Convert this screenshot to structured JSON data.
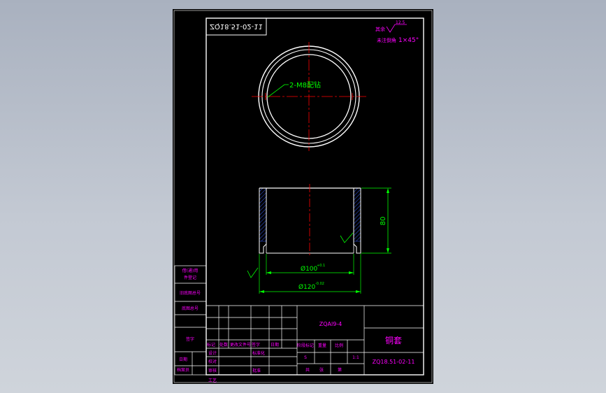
{
  "drawing": {
    "mirrored_code": "ZQ18.51-02-11",
    "roughness_prefix": "其余",
    "roughness_value": "12.5",
    "chamfer_note": "未注倒角",
    "chamfer_value": "1×45°",
    "thread_callout": "2-M8配钻",
    "dim_height": "80",
    "dim_inner": "Ø100",
    "dim_inner_tol": "+0.1",
    "dim_outer": "Ø120",
    "dim_outer_tol": "-0.02",
    "material": "ZQAl9-4",
    "part_name": "铜套",
    "drawing_number": "ZQ18.51-02-11"
  },
  "left_strip": {
    "item1": "借(通)用",
    "item2": "件登记",
    "item3": "旧底图总号",
    "item4": "底图总号",
    "item5": "签字",
    "item6": "日期",
    "item7": "档案员"
  },
  "title_block": {
    "mark": "标记",
    "count": "处数",
    "change_doc": "更改文件号",
    "signature": "签字",
    "date": "日期",
    "design": "设计",
    "check": "校对",
    "audit": "审核",
    "process": "工艺",
    "standard": "标准化",
    "approve": "批准",
    "stage_mark": "阶段标记",
    "weight": "重量",
    "scale": "比例",
    "scale_value": "1:1",
    "stage_value": "S",
    "sheet_total": "共",
    "sheet_count": "张",
    "sheet_no": "第"
  },
  "colors": {
    "background": "#000000",
    "frame": "#ffffff",
    "dimension": "#00ff00",
    "text": "#ff00ff",
    "centerline": "#ff0000",
    "hatch": "#2f4fd0"
  }
}
